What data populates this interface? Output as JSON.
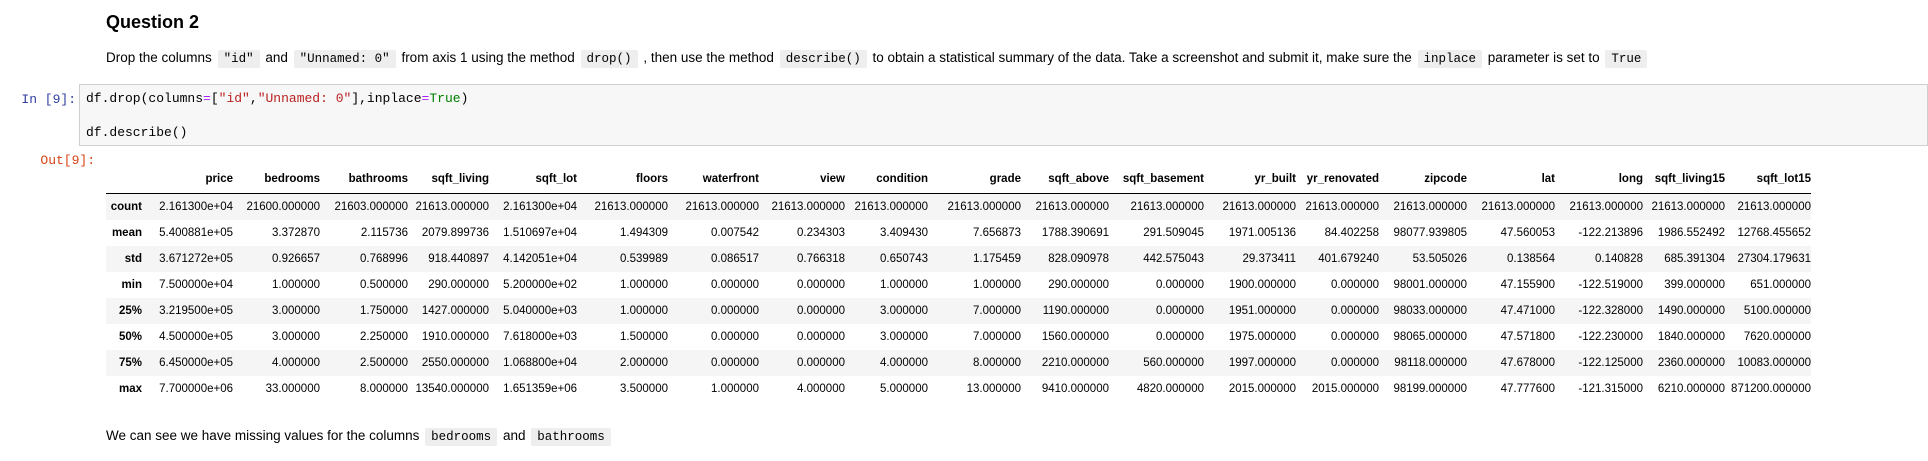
{
  "question": {
    "title": "Question 2",
    "text_1": "Drop the columns",
    "code_1": "\"id\"",
    "text_2": "and",
    "code_2": "\"Unnamed: 0\"",
    "text_3": "from axis 1 using the method",
    "code_3": "drop()",
    "text_4": ", then use the method",
    "code_4": "describe()",
    "text_5": "to obtain a statistical summary of the data. Take a screenshot and submit it, make sure the",
    "code_5": "inplace",
    "text_6": "parameter is set to",
    "code_6": "True"
  },
  "cell": {
    "in_prompt": "In [9]:",
    "out_prompt": "Out[9]:",
    "code_line1_a": "df.drop(columns",
    "code_line1_eq": "=",
    "code_line1_b": "[",
    "code_line1_s1": "\"id\"",
    "code_line1_c": ",",
    "code_line1_s2": "\"Unnamed: 0\"",
    "code_line1_d": "],inplace",
    "code_line1_eq2": "=",
    "code_line1_kw": "True",
    "code_line1_e": ")",
    "code_line2": "df.describe()"
  },
  "table": {
    "columns": [
      "price",
      "bedrooms",
      "bathrooms",
      "sqft_living",
      "sqft_lot",
      "floors",
      "waterfront",
      "view",
      "condition",
      "grade",
      "sqft_above",
      "sqft_basement",
      "yr_built",
      "yr_renovated",
      "zipcode",
      "lat",
      "long",
      "sqft_living15",
      "sqft_lot15"
    ],
    "rows": [
      {
        "label": "count",
        "values": [
          "2.161300e+04",
          "21600.000000",
          "21603.000000",
          "21613.000000",
          "2.161300e+04",
          "21613.000000",
          "21613.000000",
          "21613.000000",
          "21613.000000",
          "21613.000000",
          "21613.000000",
          "21613.000000",
          "21613.000000",
          "21613.000000",
          "21613.000000",
          "21613.000000",
          "21613.000000",
          "21613.000000",
          "21613.000000"
        ]
      },
      {
        "label": "mean",
        "values": [
          "5.400881e+05",
          "3.372870",
          "2.115736",
          "2079.899736",
          "1.510697e+04",
          "1.494309",
          "0.007542",
          "0.234303",
          "3.409430",
          "7.656873",
          "1788.390691",
          "291.509045",
          "1971.005136",
          "84.402258",
          "98077.939805",
          "47.560053",
          "-122.213896",
          "1986.552492",
          "12768.455652"
        ]
      },
      {
        "label": "std",
        "values": [
          "3.671272e+05",
          "0.926657",
          "0.768996",
          "918.440897",
          "4.142051e+04",
          "0.539989",
          "0.086517",
          "0.766318",
          "0.650743",
          "1.175459",
          "828.090978",
          "442.575043",
          "29.373411",
          "401.679240",
          "53.505026",
          "0.138564",
          "0.140828",
          "685.391304",
          "27304.179631"
        ]
      },
      {
        "label": "min",
        "values": [
          "7.500000e+04",
          "1.000000",
          "0.500000",
          "290.000000",
          "5.200000e+02",
          "1.000000",
          "0.000000",
          "0.000000",
          "1.000000",
          "1.000000",
          "290.000000",
          "0.000000",
          "1900.000000",
          "0.000000",
          "98001.000000",
          "47.155900",
          "-122.519000",
          "399.000000",
          "651.000000"
        ]
      },
      {
        "label": "25%",
        "values": [
          "3.219500e+05",
          "3.000000",
          "1.750000",
          "1427.000000",
          "5.040000e+03",
          "1.000000",
          "0.000000",
          "0.000000",
          "3.000000",
          "7.000000",
          "1190.000000",
          "0.000000",
          "1951.000000",
          "0.000000",
          "98033.000000",
          "47.471000",
          "-122.328000",
          "1490.000000",
          "5100.000000"
        ]
      },
      {
        "label": "50%",
        "values": [
          "4.500000e+05",
          "3.000000",
          "2.250000",
          "1910.000000",
          "7.618000e+03",
          "1.500000",
          "0.000000",
          "0.000000",
          "3.000000",
          "7.000000",
          "1560.000000",
          "0.000000",
          "1975.000000",
          "0.000000",
          "98065.000000",
          "47.571800",
          "-122.230000",
          "1840.000000",
          "7620.000000"
        ]
      },
      {
        "label": "75%",
        "values": [
          "6.450000e+05",
          "4.000000",
          "2.500000",
          "2550.000000",
          "1.068800e+04",
          "2.000000",
          "0.000000",
          "0.000000",
          "4.000000",
          "8.000000",
          "2210.000000",
          "560.000000",
          "1997.000000",
          "0.000000",
          "98118.000000",
          "47.678000",
          "-122.125000",
          "2360.000000",
          "10083.000000"
        ]
      },
      {
        "label": "max",
        "values": [
          "7.700000e+06",
          "33.000000",
          "8.000000",
          "13540.000000",
          "1.651359e+06",
          "3.500000",
          "1.000000",
          "4.000000",
          "5.000000",
          "13.000000",
          "9410.000000",
          "4820.000000",
          "2015.000000",
          "2015.000000",
          "98199.000000",
          "47.777600",
          "-121.315000",
          "6210.000000",
          "871200.000000"
        ]
      }
    ]
  },
  "note": {
    "text_1": "We can see we have missing values for the columns",
    "code_1": "bedrooms",
    "text_2": "and",
    "code_2": "bathrooms"
  }
}
